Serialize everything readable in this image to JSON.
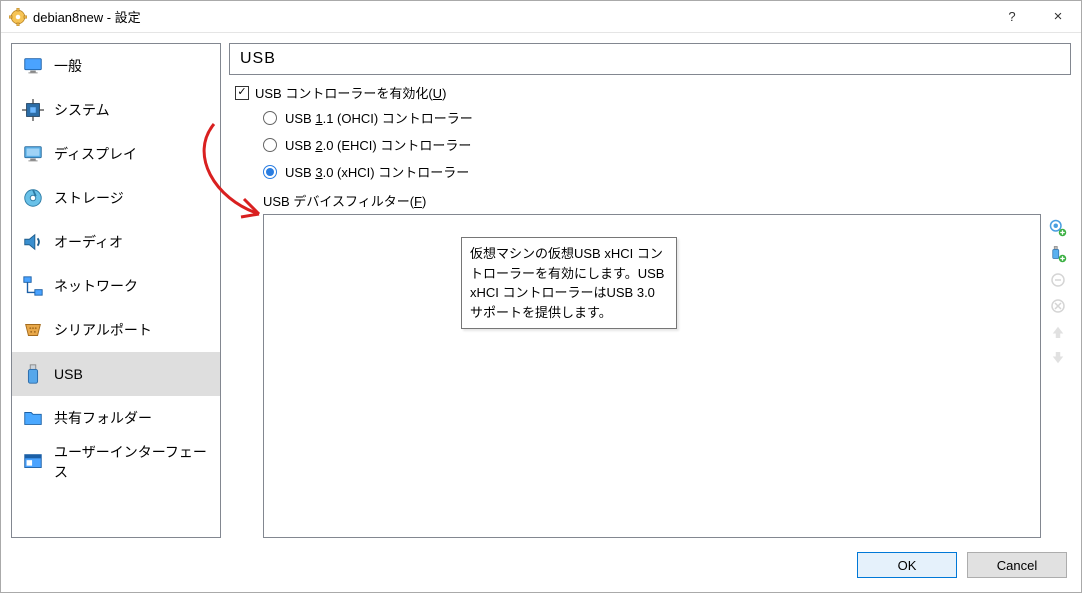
{
  "window": {
    "title": "debian8new - 設定"
  },
  "titlebar": {
    "help": "?",
    "close": "×"
  },
  "sidebar": {
    "items": [
      {
        "label": "一般"
      },
      {
        "label": "システム"
      },
      {
        "label": "ディスプレイ"
      },
      {
        "label": "ストレージ"
      },
      {
        "label": "オーディオ"
      },
      {
        "label": "ネットワーク"
      },
      {
        "label": "シリアルポート"
      },
      {
        "label": "USB"
      },
      {
        "label": "共有フォルダー"
      },
      {
        "label": "ユーザーインターフェース"
      }
    ]
  },
  "main": {
    "section_title": "USB",
    "enable_usb_label_pre": "USB コントローラーを有効化(",
    "enable_usb_accel": "U",
    "enable_usb_label_post": ")",
    "enable_usb_checked": true,
    "radios": {
      "usb11_pre": "USB ",
      "usb11_accel": "1",
      "usb11_post": ".1 (OHCI) コントローラー",
      "usb20_pre": "USB ",
      "usb20_accel": "2",
      "usb20_post": ".0 (EHCI) コントローラー",
      "usb30_pre": "USB ",
      "usb30_accel": "3",
      "usb30_post": ".0 (xHCI) コントローラー",
      "selected": "usb30"
    },
    "filter_label_pre": "USB デバイスフィルター(",
    "filter_label_accel": "F",
    "filter_label_post": ")",
    "tooltip": "仮想マシンの仮想USB xHCI コントローラーを有効にします。USB xHCI コントローラーはUSB 3.0 サポートを提供します。"
  },
  "buttons": {
    "ok": "OK",
    "cancel": "Cancel"
  }
}
